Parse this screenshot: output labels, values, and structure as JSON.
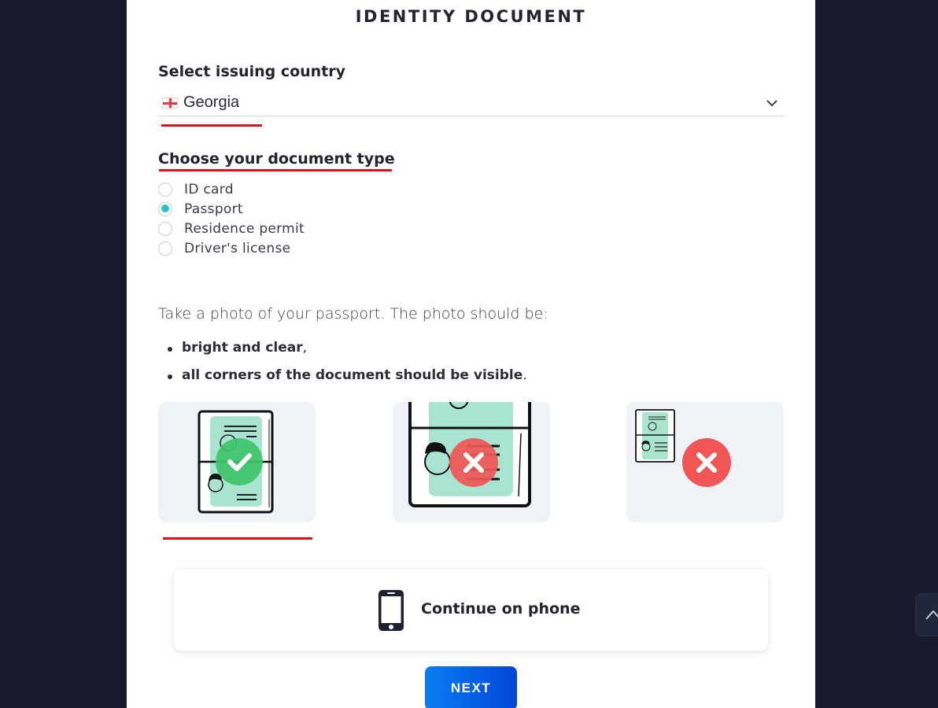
{
  "page": {
    "title": "IDENTITY DOCUMENT"
  },
  "country": {
    "label": "Select issuing country",
    "selected": "Georgia",
    "flag_icon": "georgia-flag-icon"
  },
  "document_type": {
    "label": "Choose your document type",
    "options": [
      {
        "label": "ID card",
        "checked": false
      },
      {
        "label": "Passport",
        "checked": true
      },
      {
        "label": "Residence permit",
        "checked": false
      },
      {
        "label": "Driver's license",
        "checked": false
      }
    ]
  },
  "instructions": {
    "intro": "Take a photo of your passport. The photo should be:",
    "bullets": [
      {
        "bold": "bright and clear",
        "suffix": ","
      },
      {
        "bold": "all corners of the document should be visible",
        "suffix": "."
      }
    ]
  },
  "samples": [
    {
      "name": "correct-example",
      "status": "ok"
    },
    {
      "name": "too-close-example",
      "status": "error"
    },
    {
      "name": "too-far-example",
      "status": "error"
    }
  ],
  "actions": {
    "continue_on_phone": "Continue on phone",
    "next": "NEXT"
  },
  "colors": {
    "accent_red": "#d7141a",
    "radio_checked": "#2ac2c8",
    "ok_green": "#3fc46a",
    "error_red": "#f05656",
    "doc_teal": "#a9e4d3",
    "next_gradient_start": "#0a7cf3",
    "next_gradient_end": "#0346d8",
    "background": "#181b2d"
  }
}
